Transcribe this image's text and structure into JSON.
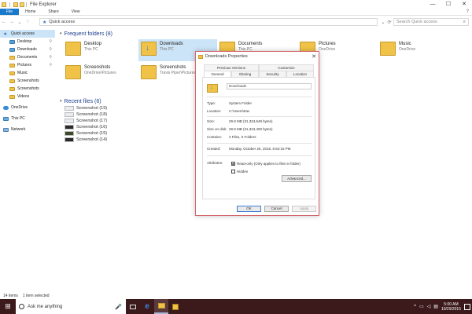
{
  "titlebar": {
    "title": "File Explorer",
    "minimize": "—",
    "maximize": "☐",
    "close": "✕"
  },
  "ribbon": {
    "tabs": [
      "File",
      "Home",
      "Share",
      "View"
    ],
    "help": "?"
  },
  "address": {
    "back": "←",
    "forward": "→",
    "recent": "⌄",
    "up": "↑",
    "path": "Quick access",
    "refresh": "⟳",
    "dropdown": "⌄",
    "search_placeholder": "Search Quick access"
  },
  "sidebar": {
    "quick_access": "Quick access",
    "items": [
      {
        "label": "Desktop",
        "pinned": true
      },
      {
        "label": "Downloads",
        "pinned": true
      },
      {
        "label": "Documents",
        "pinned": true
      },
      {
        "label": "Pictures",
        "pinned": true
      },
      {
        "label": "Music"
      },
      {
        "label": "Screenshots"
      },
      {
        "label": "Screenshots"
      },
      {
        "label": "Videos"
      }
    ],
    "onedrive": "OneDrive",
    "this_pc": "This PC",
    "network": "Network",
    "pin": "📌"
  },
  "frequent": {
    "header": "Frequent folders (8)",
    "tiles": [
      {
        "name": "Desktop",
        "sub": "This PC"
      },
      {
        "name": "Downloads",
        "sub": "This PC"
      },
      {
        "name": "Documents",
        "sub": "This PC"
      },
      {
        "name": "Pictures",
        "sub": "OneDrive"
      },
      {
        "name": "Music",
        "sub": "OneDrive"
      },
      {
        "name": "Screenshots",
        "sub": "OneDrive\\Pictures"
      },
      {
        "name": "Screenshots",
        "sub": "Travis Piper\\Pictures"
      }
    ]
  },
  "recent": {
    "header": "Recent files (6)",
    "items": [
      "Screenshot (19)",
      "Screenshot (18)",
      "Screenshot (17)",
      "Screenshot (16)",
      "Screenshot (15)",
      "Screenshot (14)"
    ]
  },
  "status": {
    "count": "14 items",
    "selected": "1 item selected"
  },
  "taskbar": {
    "search_placeholder": "Ask me anything",
    "time": "5:00 AM",
    "date": "10/29/2015"
  },
  "dialog": {
    "title": "Downloads Properties",
    "close": "✕",
    "tabs_row1": [
      "Previous Versions",
      "Customize"
    ],
    "tabs_row2": [
      "General",
      "Sharing",
      "Security",
      "Location"
    ],
    "name": "Downloads",
    "type_label": "Type:",
    "type_value": "System Folder",
    "location_label": "Location:",
    "location_value": "C:\\Users\\trav",
    "size_label": "Size:",
    "size_value": "29.8 MB (31,334,649 bytes)",
    "sizeondisk_label": "Size on disk:",
    "sizeondisk_value": "29.8 MB (31,334,400 bytes)",
    "contains_label": "Contains:",
    "contains_value": "2 Files, 0 Folders",
    "created_label": "Created:",
    "created_value": "Monday, October 26, 2015, 6:54:16 PM",
    "attributes_label": "Attributes:",
    "readonly_label": "Read-only (Only applies to files in folder)",
    "hidden_label": "Hidden",
    "advanced_label": "Advanced...",
    "ok": "OK",
    "cancel": "Cancel",
    "apply": "Apply"
  }
}
